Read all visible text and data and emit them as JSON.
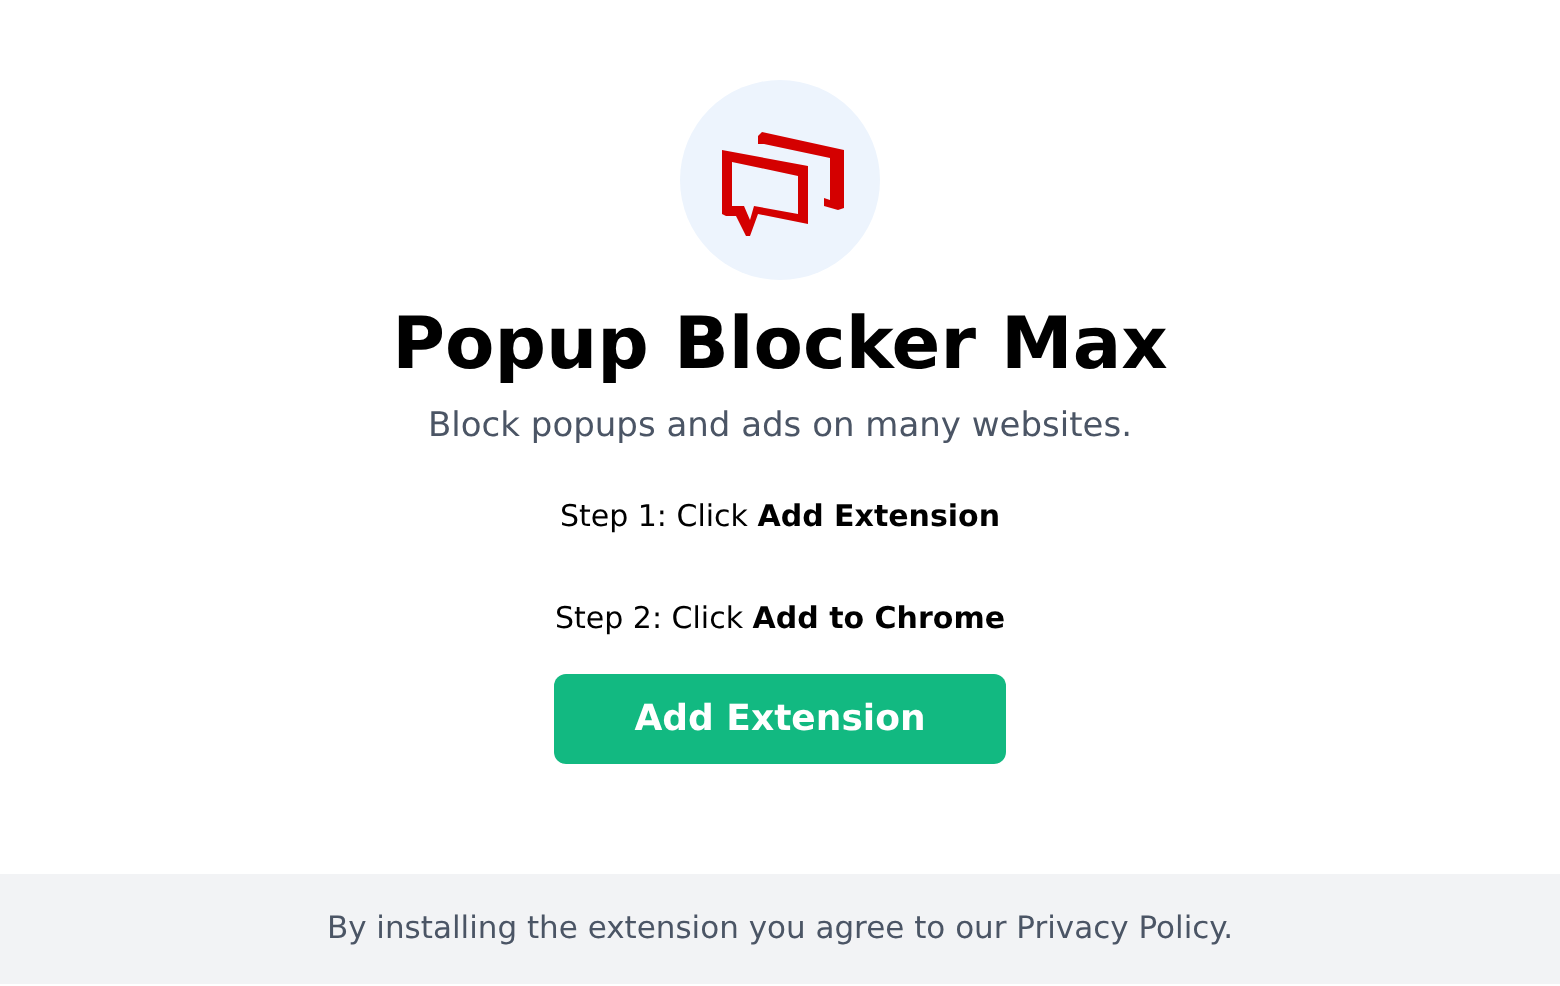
{
  "title": "Popup Blocker Max",
  "subtitle": "Block popups and ads on many websites.",
  "steps": [
    "Step 1: Click **Add Extension**",
    "Step 2: Click **Add to Chrome**"
  ],
  "button": {
    "label": "Add Extension"
  },
  "footer": "By installing the extension you agree to our Privacy Policy."
}
